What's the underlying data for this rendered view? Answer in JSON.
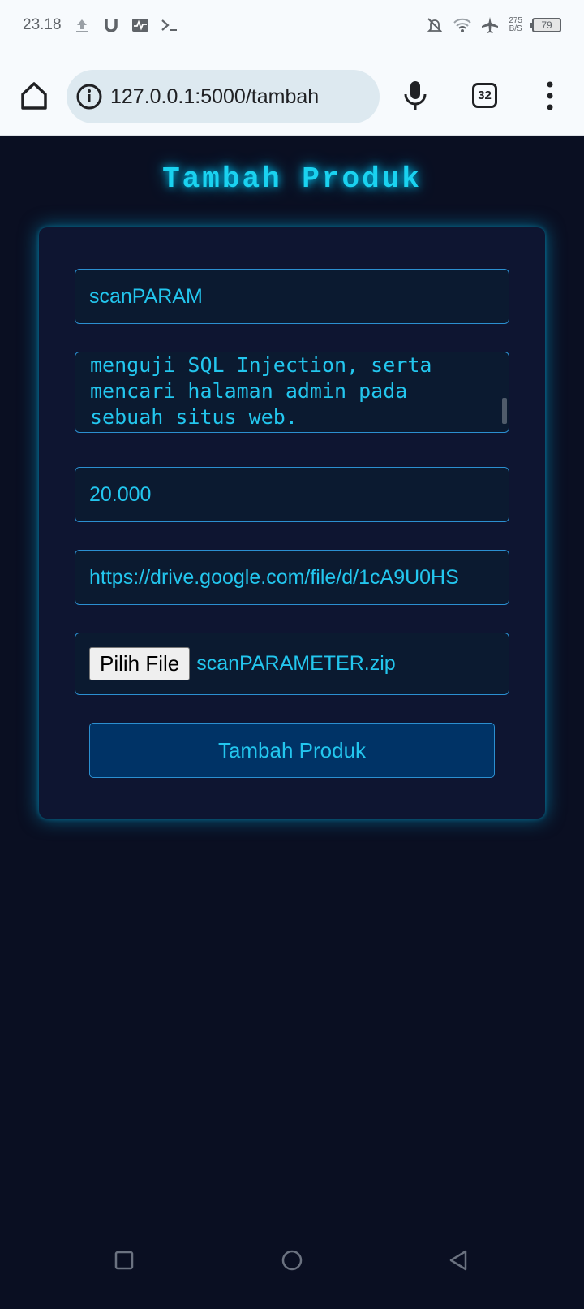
{
  "status_bar": {
    "time": "23.18",
    "net_speed_value": "275",
    "net_speed_unit": "B/S",
    "battery": "79"
  },
  "browser": {
    "url": "127.0.0.1:5000/tambah",
    "tab_count": "32"
  },
  "page": {
    "title": "Tambah Produk",
    "name_value": "scanPARAM",
    "description_lines": [
      "menguji SQL Injection, serta",
      "mencari halaman admin pada",
      "sebuah situs web."
    ],
    "price_value": "20.000",
    "link_value": "https://drive.google.com/file/d/1cA9U0HS",
    "file_button_label": "Pilih File",
    "file_name": "scanPARAMETER.zip",
    "submit_label": "Tambah Produk"
  },
  "colors": {
    "background": "#0a0f22",
    "card": "#0e1531",
    "accent": "#23c6ee",
    "button": "#003366"
  },
  "icons": [
    "upload-icon",
    "magnet-icon",
    "activity-icon",
    "terminal-icon",
    "mute-icon",
    "wifi-icon",
    "airplane-icon",
    "home-icon",
    "info-icon",
    "mic-icon",
    "menu-icon",
    "recent-apps-icon",
    "home-circle-icon",
    "back-icon"
  ]
}
